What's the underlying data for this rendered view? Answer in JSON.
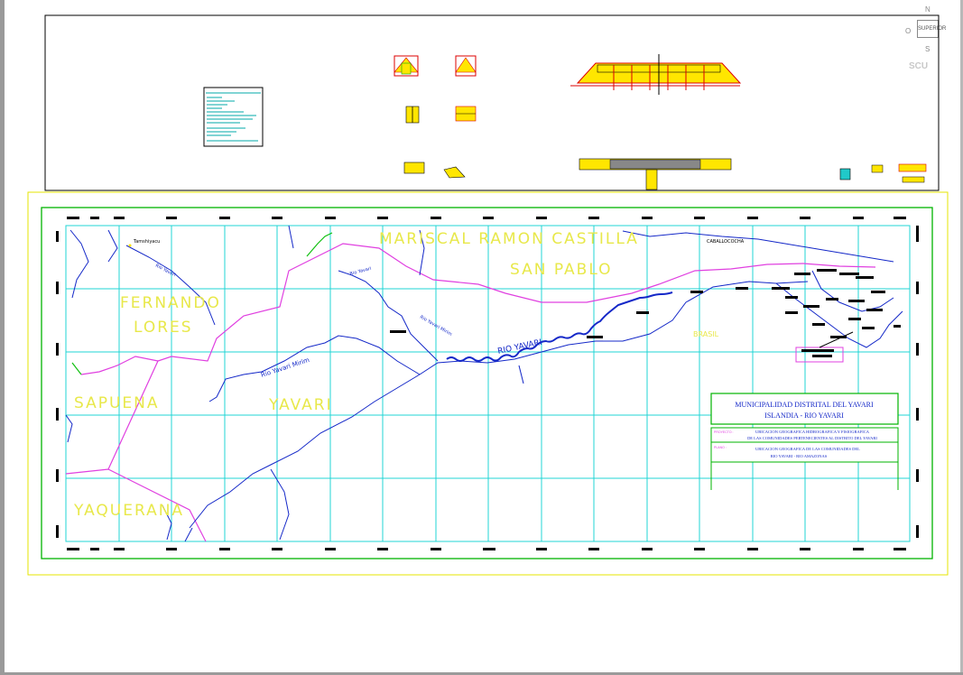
{
  "viewcube": {
    "north": "N",
    "west": "O",
    "center": "SUPERIOR",
    "south": "S",
    "wcs": "SCU"
  },
  "regions": {
    "mariscal": "MARISCAL   RAMON   CASTILLA",
    "san_pablo": "SAN PABLO",
    "fernando": "FERNANDO",
    "lores": "LORES",
    "sapuena": "SAPUENA",
    "yavari": "YAVARI",
    "yaquerana": "YAQUERANA",
    "brasil": "BRASIL"
  },
  "rivers": {
    "yavari_main": "RIO YAVARI",
    "yavari_mirim": "Rio Yavari Mirim",
    "yavari_mirim_2": "Rio Yavari Mirim",
    "yavari_upper": "Rio Yavari",
    "yavari_tributary": "Rio Yavari"
  },
  "towns": {
    "left": "Tamshiyacu",
    "right": "CABALLOCOCHA"
  },
  "title_block": {
    "line1": "MUNICIPALIDAD DISTRITAL DEL YAVARI",
    "line2": "ISLANDIA - RIO YAVARI",
    "proyecto_label": "PROYECTO :",
    "proyecto_text_1": "UBICACION GEOGRAFICA HIDROGRAFICA Y FISIOGRAFICA",
    "proyecto_text_2": "DE LAS COMUNIDADES PERTENECIENTES AL DISTRITO DEL YAVARI",
    "plano_label": "PLANO :",
    "plano_text_1": "UBICACION GEOGRAFICA DE LAS COMUNIDADES DEL",
    "plano_text_2": "RIO YAVARI - RIO AMAZONAS"
  }
}
